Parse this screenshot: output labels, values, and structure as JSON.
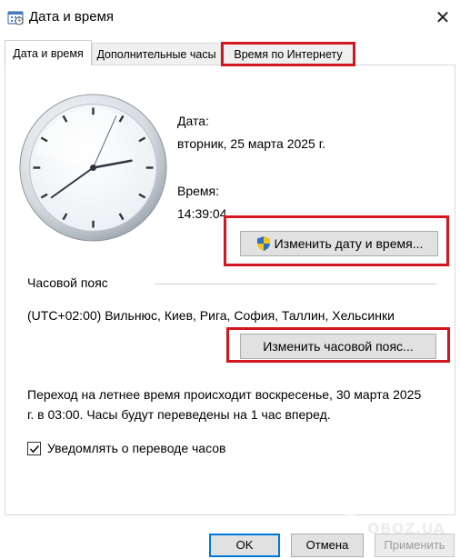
{
  "window": {
    "title": "Дата и время",
    "title_icon": "date-time-control-panel-icon",
    "close_glyph": "✕"
  },
  "tabs": [
    {
      "label": "Дата и время",
      "active": true
    },
    {
      "label": "Дополнительные часы",
      "active": false
    },
    {
      "label": "Время по Интернету",
      "active": false
    }
  ],
  "date_section": {
    "date_label": "Дата:",
    "date_value": "вторник, 25 марта 2025 г.",
    "time_label": "Время:",
    "time_value": "14:39:04",
    "change_button": "Изменить дату и время...",
    "clock": {
      "hours": 14,
      "minutes": 39,
      "seconds": 4
    }
  },
  "timezone_section": {
    "header": "Часовой пояс",
    "value": "(UTC+02:00) Вильнюс, Киев, Рига, София, Таллин, Хельсинки",
    "change_button": "Изменить часовой пояс..."
  },
  "dst": {
    "text": "Переход на летнее время происходит воскресенье, 30 марта 2025 г. в 03:00. Часы будут переведены на 1 час вперед.",
    "notify_label": "Уведомлять о переводе часов",
    "notify_checked": true
  },
  "footer": {
    "ok": "OK",
    "cancel": "Отмена",
    "apply": "Применить"
  },
  "watermark": "OBOZ.UA",
  "colors": {
    "highlight": "#d3161f",
    "button_face": "#e1e1e1",
    "focus_border": "#0078d7"
  }
}
